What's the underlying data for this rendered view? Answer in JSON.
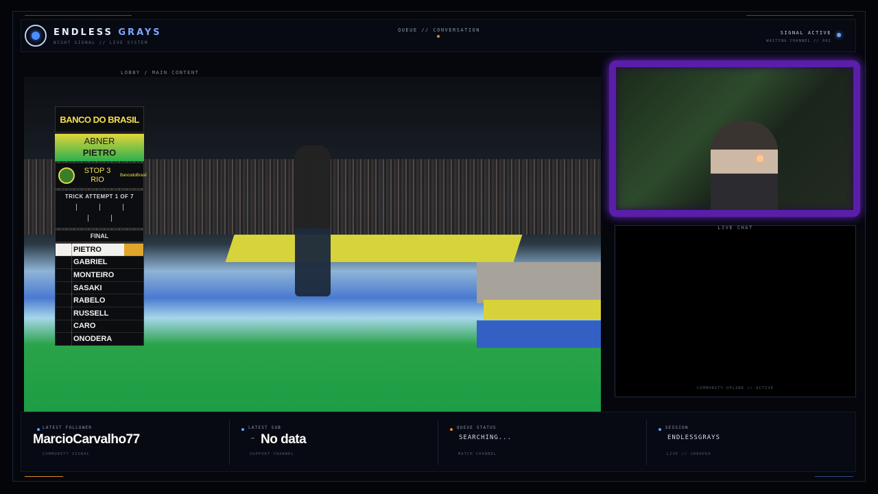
{
  "brand": {
    "name": "ENDLESS",
    "name_accent": "GRAYS",
    "tagline": "NIGHT SIGNAL // LIVE SYSTEM"
  },
  "top": {
    "center_label": "QUEUE // CONVERSATION",
    "status": "SIGNAL ACTIVE",
    "status_sub": "WAITING CHANNEL // 002"
  },
  "main": {
    "label": "LOBBY / MAIN CONTENT"
  },
  "scoreboard": {
    "sponsor": "BANCO DO BRASIL",
    "athlete_first": "ABNER",
    "athlete_last": "PIETRO",
    "event_line1": "STOP 3",
    "event_line2": "RIO",
    "mini_logo": "BancodoBrasil",
    "trick_label": "TRICK ATTEMPT 1 OF 7",
    "round": "FINAL",
    "ranking": [
      "PIETRO",
      "GABRIEL",
      "MONTEIRO",
      "SASAKI",
      "RABELO",
      "RUSSELL",
      "CARO",
      "ONODERA"
    ]
  },
  "chat": {
    "title": "LIVE CHAT",
    "footer": "COMMUNITY UPLINK // ACTIVE"
  },
  "bottom": {
    "follower": {
      "label": "LATEST FOLLOWER",
      "value": "MarcioCarvalho77",
      "sub": "COMMUNITY SIGNAL"
    },
    "sub": {
      "label": "LATEST SUB",
      "prefix": "–",
      "value": "No data",
      "sub": "SUPPORT CHANNEL"
    },
    "queue": {
      "label": "QUEUE STATUS",
      "value": "SEARCHING...",
      "sub": "MATCH CHANNEL"
    },
    "session": {
      "label": "SESSION",
      "value": "ENDLESSGRAYS",
      "sub": "LIVE // 1080P60"
    }
  },
  "colors": {
    "accent_blue": "#6aa4ff",
    "accent_orange": "#e08a2a",
    "cam_border": "#5a1ea8"
  }
}
